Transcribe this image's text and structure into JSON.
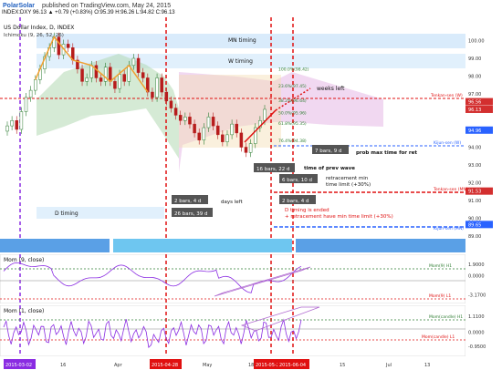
{
  "header": {
    "brand": "PolarSolar",
    "published": "published on TradingView.com, May 24, 2015",
    "symbol_line": "INDEX:DXY 96.13 ▲ +0.79 (+0.83%) O:95.39 H:96.26 L:94.82 C:96.13"
  },
  "colors": {
    "up": "#2e7d32",
    "down": "#b71c1c",
    "ichimoku_cloud_bull": "#b3d9b3",
    "ichimoku_cloud_bear": "#e6b8e6",
    "pattern": "#f0a030",
    "timing_band": "#cfe6fa",
    "price_label": "#d32f2f",
    "kijun_label": "#2962ff",
    "vline_red": "#e01010",
    "vline_purple": "#8a2be2",
    "momentum": "#8a2be2"
  },
  "chart_data": [
    {
      "type": "line",
      "title": "US Dollar Index, D, INDEX",
      "subtitle": "Ichimoku (9, 26, 52, 26)",
      "ylim": [
        89.0,
        101.0
      ],
      "y_ticks": [
        "100.00",
        "99.00",
        "98.00",
        "97.00",
        "96.13",
        "95.00",
        "94.00",
        "93.00",
        "92.00",
        "91.00",
        "90.00",
        "89.00"
      ],
      "x_ticks": [
        "16",
        "Apr",
        "15",
        "May",
        "18",
        "Jun",
        "15",
        "Jul",
        "13"
      ],
      "x_date_labels": [
        "2015-03-02",
        "2015-04-28",
        "2015-05-26",
        "2015-06-04"
      ],
      "price_close": [
        95.2,
        95.5,
        95.0,
        96.0,
        96.8,
        97.2,
        97.8,
        98.4,
        99.1,
        99.6,
        100.2,
        99.2,
        99.8,
        99.6,
        98.9,
        98.4,
        97.7,
        97.9,
        98.6,
        97.9,
        97.7,
        98.5,
        97.7,
        97.3,
        98.1,
        97.7,
        98.6,
        99.0,
        98.2,
        97.9,
        97.1,
        96.8,
        97.9,
        97.1,
        96.6,
        96.2,
        95.8,
        95.5,
        95.7,
        95.3,
        94.8,
        94.4,
        95.1,
        95.7,
        95.2,
        94.7,
        94.3,
        94.7,
        95.3,
        94.8,
        94.0,
        93.7,
        94.2,
        95.1,
        95.5,
        96.13
      ],
      "price_labels": [
        {
          "text": "96.56",
          "value": 96.56
        },
        {
          "text": "96.13",
          "value": 96.13
        },
        {
          "text": "94.96",
          "value": 94.96
        },
        {
          "text": "91.53",
          "value": 91.53
        },
        {
          "text": "89.65",
          "value": 89.65
        }
      ],
      "fib_labels": [
        "100.0%(98.42)",
        "23.6%(97.45)",
        "38.2%(96.64)",
        "50.0%(95.96)",
        "61.8%(95.35)",
        "76.4%(94.38)"
      ],
      "pattern_points": [
        "A",
        "B",
        "C",
        "D",
        "C",
        "B",
        "A"
      ],
      "pattern_points_down": [
        "3",
        "4",
        "5",
        "1",
        "2",
        "3",
        "4",
        "5"
      ],
      "annotations": {
        "m_timing": "MN timing",
        "w_timing": "W timing",
        "d_timing": "D timing",
        "weeks_left": "weeks left",
        "tenkan_w": "Tenkan-sen (W)",
        "kijun_w": "Kijun-sen (W)",
        "tenkan_mn": "Tenkan-sen (MN)",
        "kijun_mn": "Kijun-sen (MN)",
        "bars_7": "7 bars, 9 d",
        "prob_max": "prob max time for ret",
        "bars_16": "16 bars, 22 d",
        "time_prev_wave": "time of prev wave",
        "bars_6": "6 bars, 10 d",
        "ret_min": "retracement min",
        "ret_min2": "time limit (+30%)",
        "bars_2a": "2 bars, 4 d",
        "days_left": "days left",
        "bars_2b": "2 bars, 4 d",
        "bars_26": "26 bars, 39 d",
        "d_ended": "D timing is ended",
        "d_ended2": "+ retracement have min time limit (+30%)"
      }
    },
    {
      "type": "line",
      "title": "Mom (9, close)",
      "y_ticks": [
        "1.9000",
        "0.0000",
        "-3.1700"
      ],
      "labels": [
        {
          "text": "Mom(9) H1",
          "value": 1.9
        },
        {
          "text": "Mom(9) L1",
          "value": -3.17
        }
      ]
    },
    {
      "type": "line",
      "title": "Mom (1, close)",
      "y_ticks": [
        "1.1100",
        "0.0000",
        "-0.9500"
      ],
      "labels": [
        {
          "text": "Mom(candle) H1",
          "value": 1.11
        },
        {
          "text": "Mom(candle) L1",
          "value": -0.95
        }
      ]
    }
  ]
}
